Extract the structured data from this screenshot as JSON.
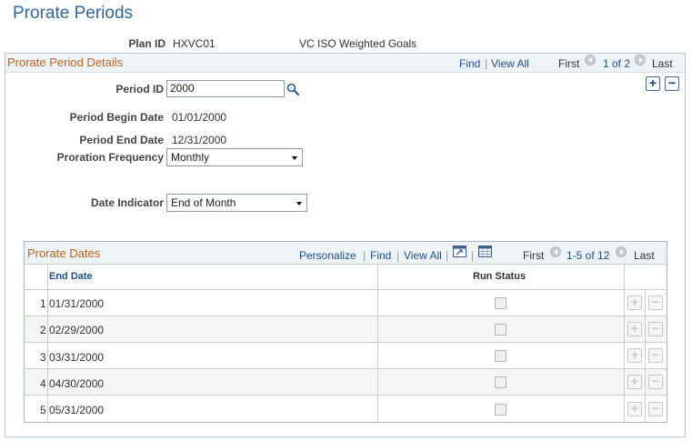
{
  "page": {
    "title": "Prorate Periods"
  },
  "plan": {
    "label": "Plan ID",
    "id": "HXVC01",
    "description": "VC ISO Weighted Goals"
  },
  "details": {
    "title": "Prorate Period Details",
    "nav": {
      "find": "Find",
      "view_all": "View All",
      "first": "First",
      "range": "1 of 2",
      "last": "Last"
    },
    "period_id": {
      "label": "Period ID",
      "value": "2000"
    },
    "begin_date": {
      "label": "Period Begin Date",
      "value": "01/01/2000"
    },
    "end_date": {
      "label": "Period End Date",
      "value": "12/31/2000"
    },
    "frequency": {
      "label": "Proration Frequency",
      "value": "Monthly"
    },
    "date_indicator": {
      "label": "Date Indicator",
      "value": "End of Month"
    },
    "add_symbol": "+",
    "remove_symbol": "−"
  },
  "grid": {
    "title": "Prorate Dates",
    "nav": {
      "personalize": "Personalize",
      "find": "Find",
      "view_all": "View All",
      "first": "First",
      "range": "1-5 of 12",
      "last": "Last"
    },
    "columns": {
      "end_date": "End Date",
      "run_status": "Run Status"
    },
    "rows": [
      {
        "num": "1",
        "end_date": "01/31/2000"
      },
      {
        "num": "2",
        "end_date": "02/29/2000"
      },
      {
        "num": "3",
        "end_date": "03/31/2000"
      },
      {
        "num": "4",
        "end_date": "04/30/2000"
      },
      {
        "num": "5",
        "end_date": "05/31/2000"
      }
    ]
  },
  "icons": {
    "lookup": "magnifier-icon",
    "first": "chevron-left-icon",
    "last": "chevron-right-icon",
    "zoom": "zoom-grid-icon",
    "download": "download-spreadsheet-icon"
  },
  "colors": {
    "title": "#336699",
    "group_title": "#c1631c",
    "link": "#1f4f8f",
    "header_bg": "#eef3f8",
    "border": "#b9c8d8"
  }
}
